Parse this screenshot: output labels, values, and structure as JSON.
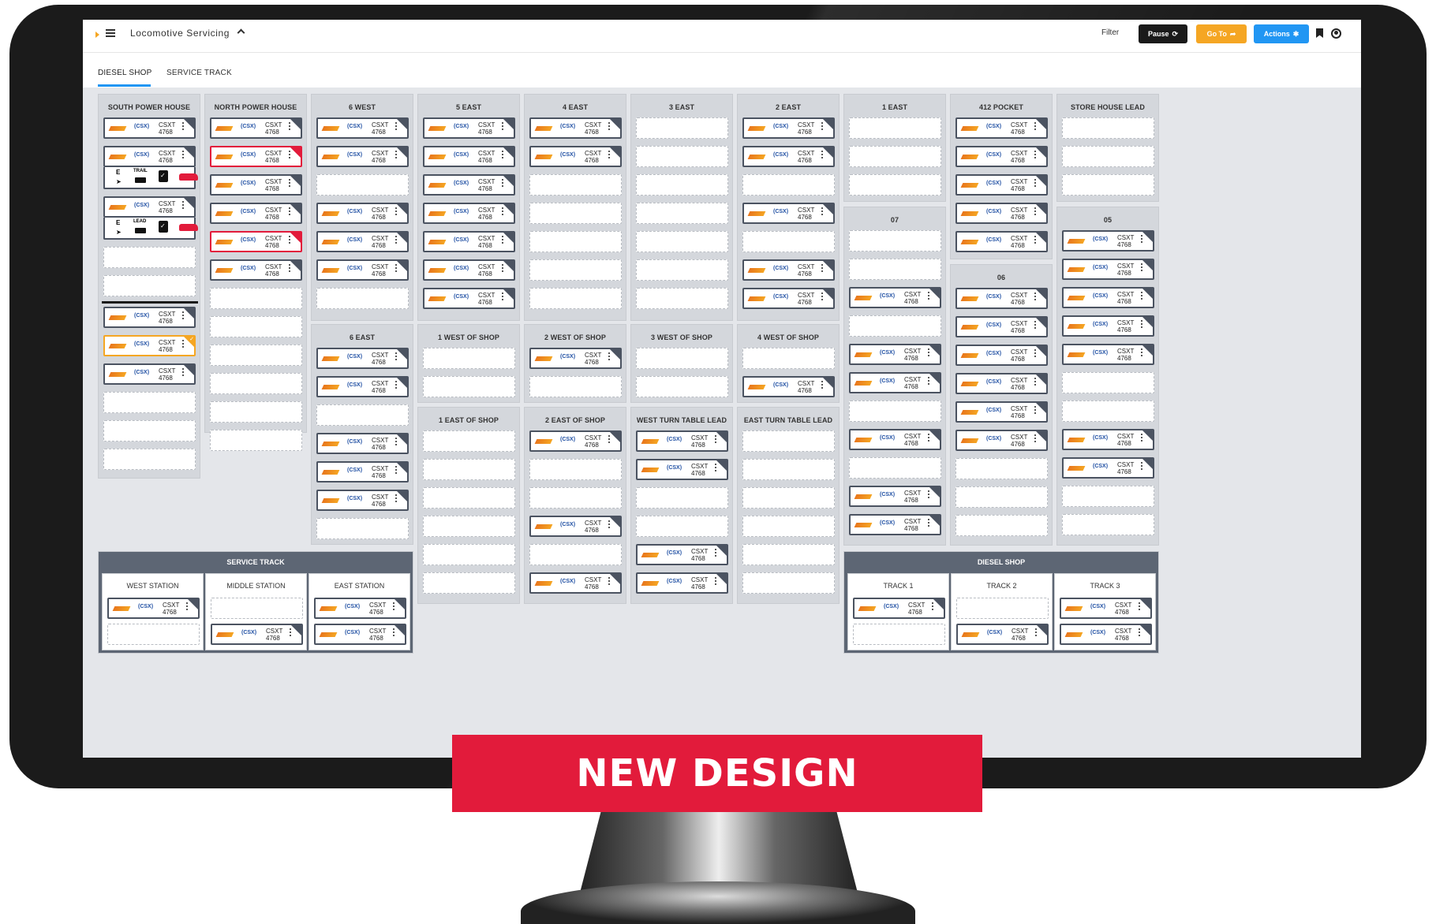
{
  "app": {
    "title": "Locomotive Servicing",
    "filter_label": "Filter",
    "pause_label": "Pause",
    "goto_label": "Go To",
    "actions_label": "Actions",
    "accent_color": "#2196f3"
  },
  "tabs": [
    {
      "label": "DIESEL SHOP",
      "active": true
    },
    {
      "label": "SERVICE TRACK",
      "active": false
    }
  ],
  "card": {
    "road": "CSXT",
    "number": "4768",
    "csx_mark": "(CSX)"
  },
  "south_detail": {
    "trail": {
      "e": "E",
      "tag": "TRAIL"
    },
    "lead": {
      "e": "E",
      "tag": "LEAD"
    }
  },
  "tracks": {
    "south_power_house": "SOUTH POWER HOUSE",
    "north_power_house": "NORTH POWER HOUSE",
    "w6": "6 WEST",
    "e5": "5 EAST",
    "e4": "4 EAST",
    "e3": "3 EAST",
    "e2": "2 EAST",
    "e1": "1 EAST",
    "pocket412": "412 POCKET",
    "store_house_lead": "STORE HOUSE LEAD",
    "e6": "6 EAST",
    "w1_shop": "1 WEST OF SHOP",
    "w2_shop": "2 WEST OF SHOP",
    "w3_shop": "3 WEST OF SHOP",
    "w4_shop": "4 WEST OF SHOP",
    "e1_shop": "1 EAST OF SHOP",
    "e2_shop": "2 EAST OF SHOP",
    "west_turn": "WEST TURN TABLE LEAD",
    "east_turn": "EAST TURN TABLE LEAD",
    "t07": "07",
    "t06": "06",
    "t05": "05"
  },
  "service_track": {
    "title": "SERVICE TRACK",
    "west": "WEST STATION",
    "middle": "MIDDLE STATION",
    "east": "EAST STATION"
  },
  "diesel_shop": {
    "title": "DIESEL SHOP",
    "t1": "TRACK 1",
    "t2": "TRACK 2",
    "t3": "TRACK 3"
  },
  "banner": "NEW DESIGN"
}
